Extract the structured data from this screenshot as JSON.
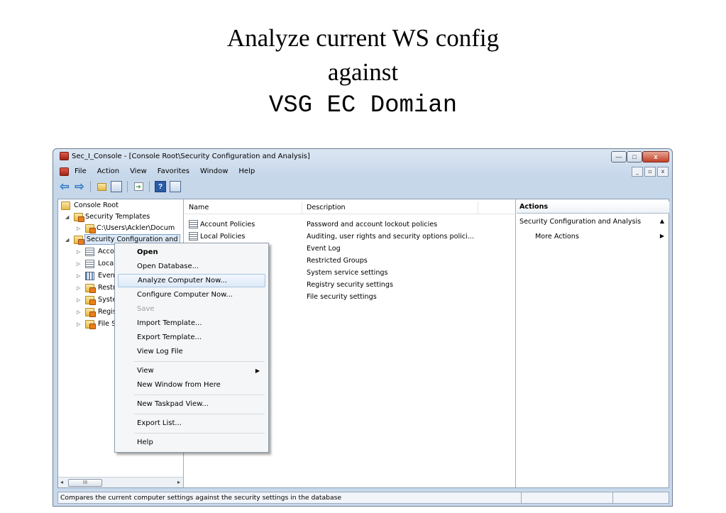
{
  "slide": {
    "title_line1": "Analyze current WS config",
    "title_line2": "against",
    "title_line3": "VSG EC Domian"
  },
  "window": {
    "title": "Sec_I_Console - [Console Root\\Security Configuration and Analysis]",
    "controls": {
      "minimize": "—",
      "maximize": "□",
      "close": "x"
    },
    "mdi_controls": {
      "minimize": "_",
      "restore": "▫",
      "close": "x"
    }
  },
  "menu": [
    "File",
    "Action",
    "View",
    "Favorites",
    "Window",
    "Help"
  ],
  "toolbar": {
    "icons": [
      "back-arrow-icon",
      "forward-arrow-icon",
      "up-folder-icon",
      "show-hide-tree-icon",
      "export-list-icon",
      "help-icon",
      "show-hide-action-pane-icon"
    ],
    "help_label": "?"
  },
  "tree": {
    "items": [
      {
        "label": "Console Root",
        "icon": "folder-icon"
      },
      {
        "label": "Security Templates",
        "icon": "lock-folder-icon"
      },
      {
        "label": "C:\\Users\\Ackler\\Docum",
        "icon": "lock-folder-icon"
      },
      {
        "label": "Security Configuration and",
        "icon": "lock-folder-icon"
      },
      {
        "label": "Acco",
        "icon": "policy-icon"
      },
      {
        "label": "Loca",
        "icon": "policy-icon"
      },
      {
        "label": "Even",
        "icon": "log-icon"
      },
      {
        "label": "Restr",
        "icon": "lock-folder-icon"
      },
      {
        "label": "Syste",
        "icon": "lock-folder-icon"
      },
      {
        "label": "Regis",
        "icon": "lock-folder-icon"
      },
      {
        "label": "File S",
        "icon": "lock-folder-icon"
      }
    ],
    "scroll_thumb_label": "III"
  },
  "list": {
    "columns": [
      "Name",
      "Description"
    ],
    "rows": [
      {
        "name": "Account Policies",
        "description": "Password and account lockout policies"
      },
      {
        "name": "Local Policies",
        "description": "Auditing, user rights and security options polici..."
      },
      {
        "name": "",
        "description": "Event Log"
      },
      {
        "name": "",
        "description": "Restricted Groups"
      },
      {
        "name": "",
        "description": "System service settings"
      },
      {
        "name": "",
        "description": "Registry security settings"
      },
      {
        "name": "",
        "description": "File security settings"
      }
    ]
  },
  "actions": {
    "header": "Actions",
    "section": "Security Configuration and Analysis",
    "more": "More Actions"
  },
  "context_menu": {
    "items": [
      {
        "label": "Open",
        "bold": true
      },
      {
        "label": "Open Database..."
      },
      {
        "label": "Analyze Computer Now...",
        "highlighted": true
      },
      {
        "label": "Configure Computer Now..."
      },
      {
        "label": "Save",
        "disabled": true
      },
      {
        "label": "Import Template..."
      },
      {
        "label": "Export Template..."
      },
      {
        "label": "View Log File"
      },
      {
        "label": "View",
        "submenu": true
      },
      {
        "label": "New Window from Here"
      },
      {
        "label": "New Taskpad View..."
      },
      {
        "label": "Export List..."
      },
      {
        "label": "Help"
      }
    ]
  },
  "status": {
    "text": "Compares the current computer settings against the security settings in the database"
  },
  "colors": {
    "window_frame": "#c6d7ea",
    "menu_highlight": "#dde9f8",
    "selection": "#dde9f6"
  }
}
